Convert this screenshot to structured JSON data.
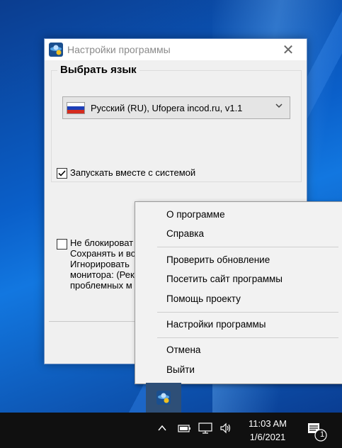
{
  "window": {
    "title": "Настройки программы",
    "close_glyph": "✕",
    "language_group_title": "Выбрать язык",
    "language_selected": "Русский (RU), Ufopera incod.ru, v1.1",
    "autostart_label": "Запускать вместе с системой",
    "autostart_checked": true,
    "block_lines": [
      "Не блокироват",
      "Сохранять и во",
      "Игнорировать",
      "монитора: (Рек",
      "проблемных м"
    ],
    "block_checked": false
  },
  "context_menu": {
    "items": [
      "О программе",
      "Справка",
      "Проверить обновление",
      "Посетить сайт программы",
      "Помощь проекту",
      "Настройки программы",
      "Отмена",
      "Выйти"
    ]
  },
  "taskbar": {
    "time": "11:03 AM",
    "date": "1/6/2021",
    "notification_count": "1"
  },
  "icons": {
    "app": "ufo-app-icon",
    "chevron_up": "chevron-up-icon",
    "battery": "battery-icon",
    "network": "network-icon",
    "volume": "volume-icon",
    "notifications": "notifications-icon"
  },
  "colors": {
    "flag_white": "#ffffff",
    "flag_blue": "#1c3fb8",
    "flag_red": "#d52b1e"
  }
}
